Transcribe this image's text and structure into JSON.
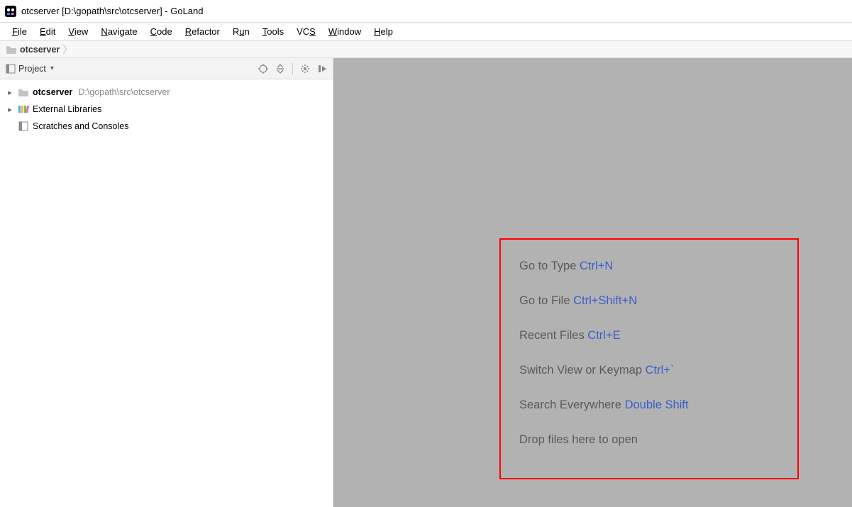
{
  "window": {
    "title": "otcserver [D:\\gopath\\src\\otcserver] - GoLand"
  },
  "menu": {
    "items": [
      "File",
      "Edit",
      "View",
      "Navigate",
      "Code",
      "Refactor",
      "Run",
      "Tools",
      "VCS",
      "Window",
      "Help"
    ]
  },
  "breadcrumb": {
    "name": "otcserver"
  },
  "sidebar": {
    "toolbar_label": "Project",
    "tree": {
      "project_name": "otcserver",
      "project_path": "D:\\gopath\\src\\otcserver",
      "ext_libs": "External Libraries",
      "scratches": "Scratches and Consoles"
    }
  },
  "hints": {
    "h0_text": "Go to Type ",
    "h0_key": "Ctrl+N",
    "h1_text": "Go to File ",
    "h1_key": "Ctrl+Shift+N",
    "h2_text": "Recent Files ",
    "h2_key": "Ctrl+E",
    "h3_text": "Switch View or Keymap ",
    "h3_key": "Ctrl+`",
    "h4_text": "Search Everywhere ",
    "h4_key": "Double Shift",
    "h5_text": "Drop files here to open",
    "h5_key": ""
  }
}
